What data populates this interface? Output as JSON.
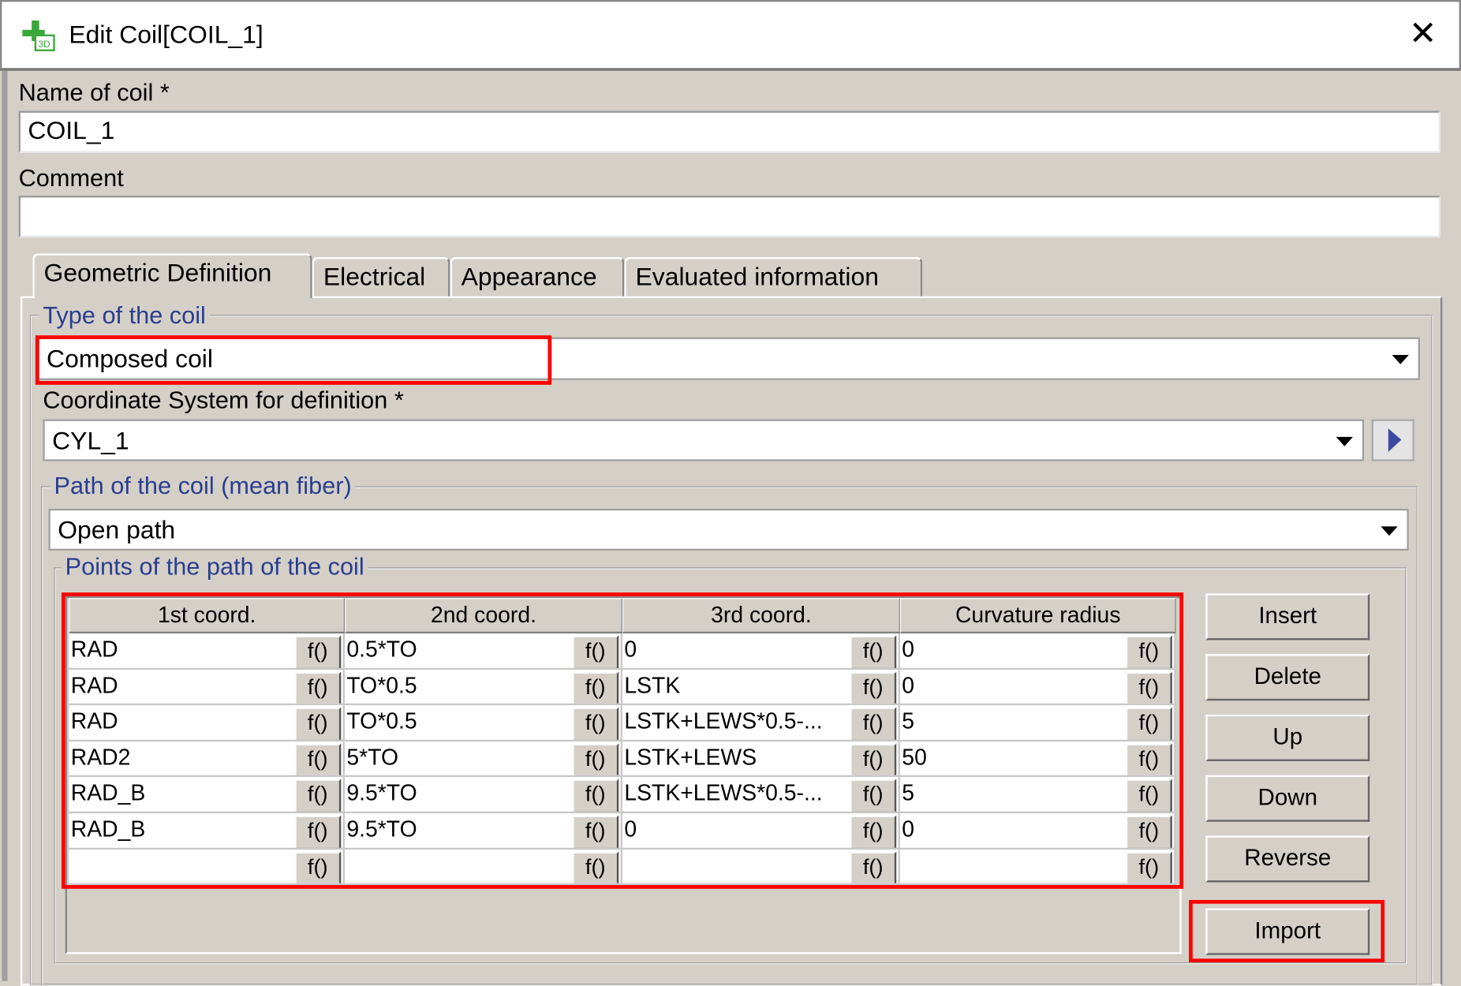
{
  "window": {
    "title": "Edit Coil[COIL_1]",
    "icon": "coil-3d-app-icon",
    "close_icon": "close-icon"
  },
  "name_field": {
    "label": "Name of coil *",
    "value": "COIL_1"
  },
  "comment_field": {
    "label": "Comment",
    "value": ""
  },
  "tabs": [
    {
      "label": "Geometric Definition",
      "active": true
    },
    {
      "label": "Electrical"
    },
    {
      "label": "Appearance"
    },
    {
      "label": "Evaluated information"
    }
  ],
  "type_group": {
    "label": "Type of the coil",
    "value": "Composed coil"
  },
  "coord_system": {
    "label": "Coordinate System for definition *",
    "value": "CYL_1"
  },
  "path_group": {
    "label": "Path of the coil (mean fiber)",
    "value": "Open path"
  },
  "points_group": {
    "label": "Points of the path of the coil"
  },
  "table": {
    "columns": [
      "1st coord.",
      "2nd coord.",
      "3rd coord.",
      "Curvature radius"
    ],
    "func_label": "f()",
    "rows": [
      [
        "RAD",
        "0.5*TO",
        "0",
        "0"
      ],
      [
        "RAD",
        "TO*0.5",
        "LSTK",
        "0"
      ],
      [
        "RAD",
        "TO*0.5",
        "LSTK+LEWS*0.5-...",
        "5"
      ],
      [
        "RAD2",
        "5*TO",
        "LSTK+LEWS",
        "50"
      ],
      [
        "RAD_B",
        "9.5*TO",
        "LSTK+LEWS*0.5-...",
        "5"
      ],
      [
        "RAD_B",
        "9.5*TO",
        "0",
        "0"
      ],
      [
        "",
        "",
        "",
        ""
      ]
    ]
  },
  "buttons": {
    "insert": "Insert",
    "delete": "Delete",
    "up": "Up",
    "down": "Down",
    "reverse": "Reverse",
    "import": "Import"
  },
  "highlight_color": "#ff0000"
}
